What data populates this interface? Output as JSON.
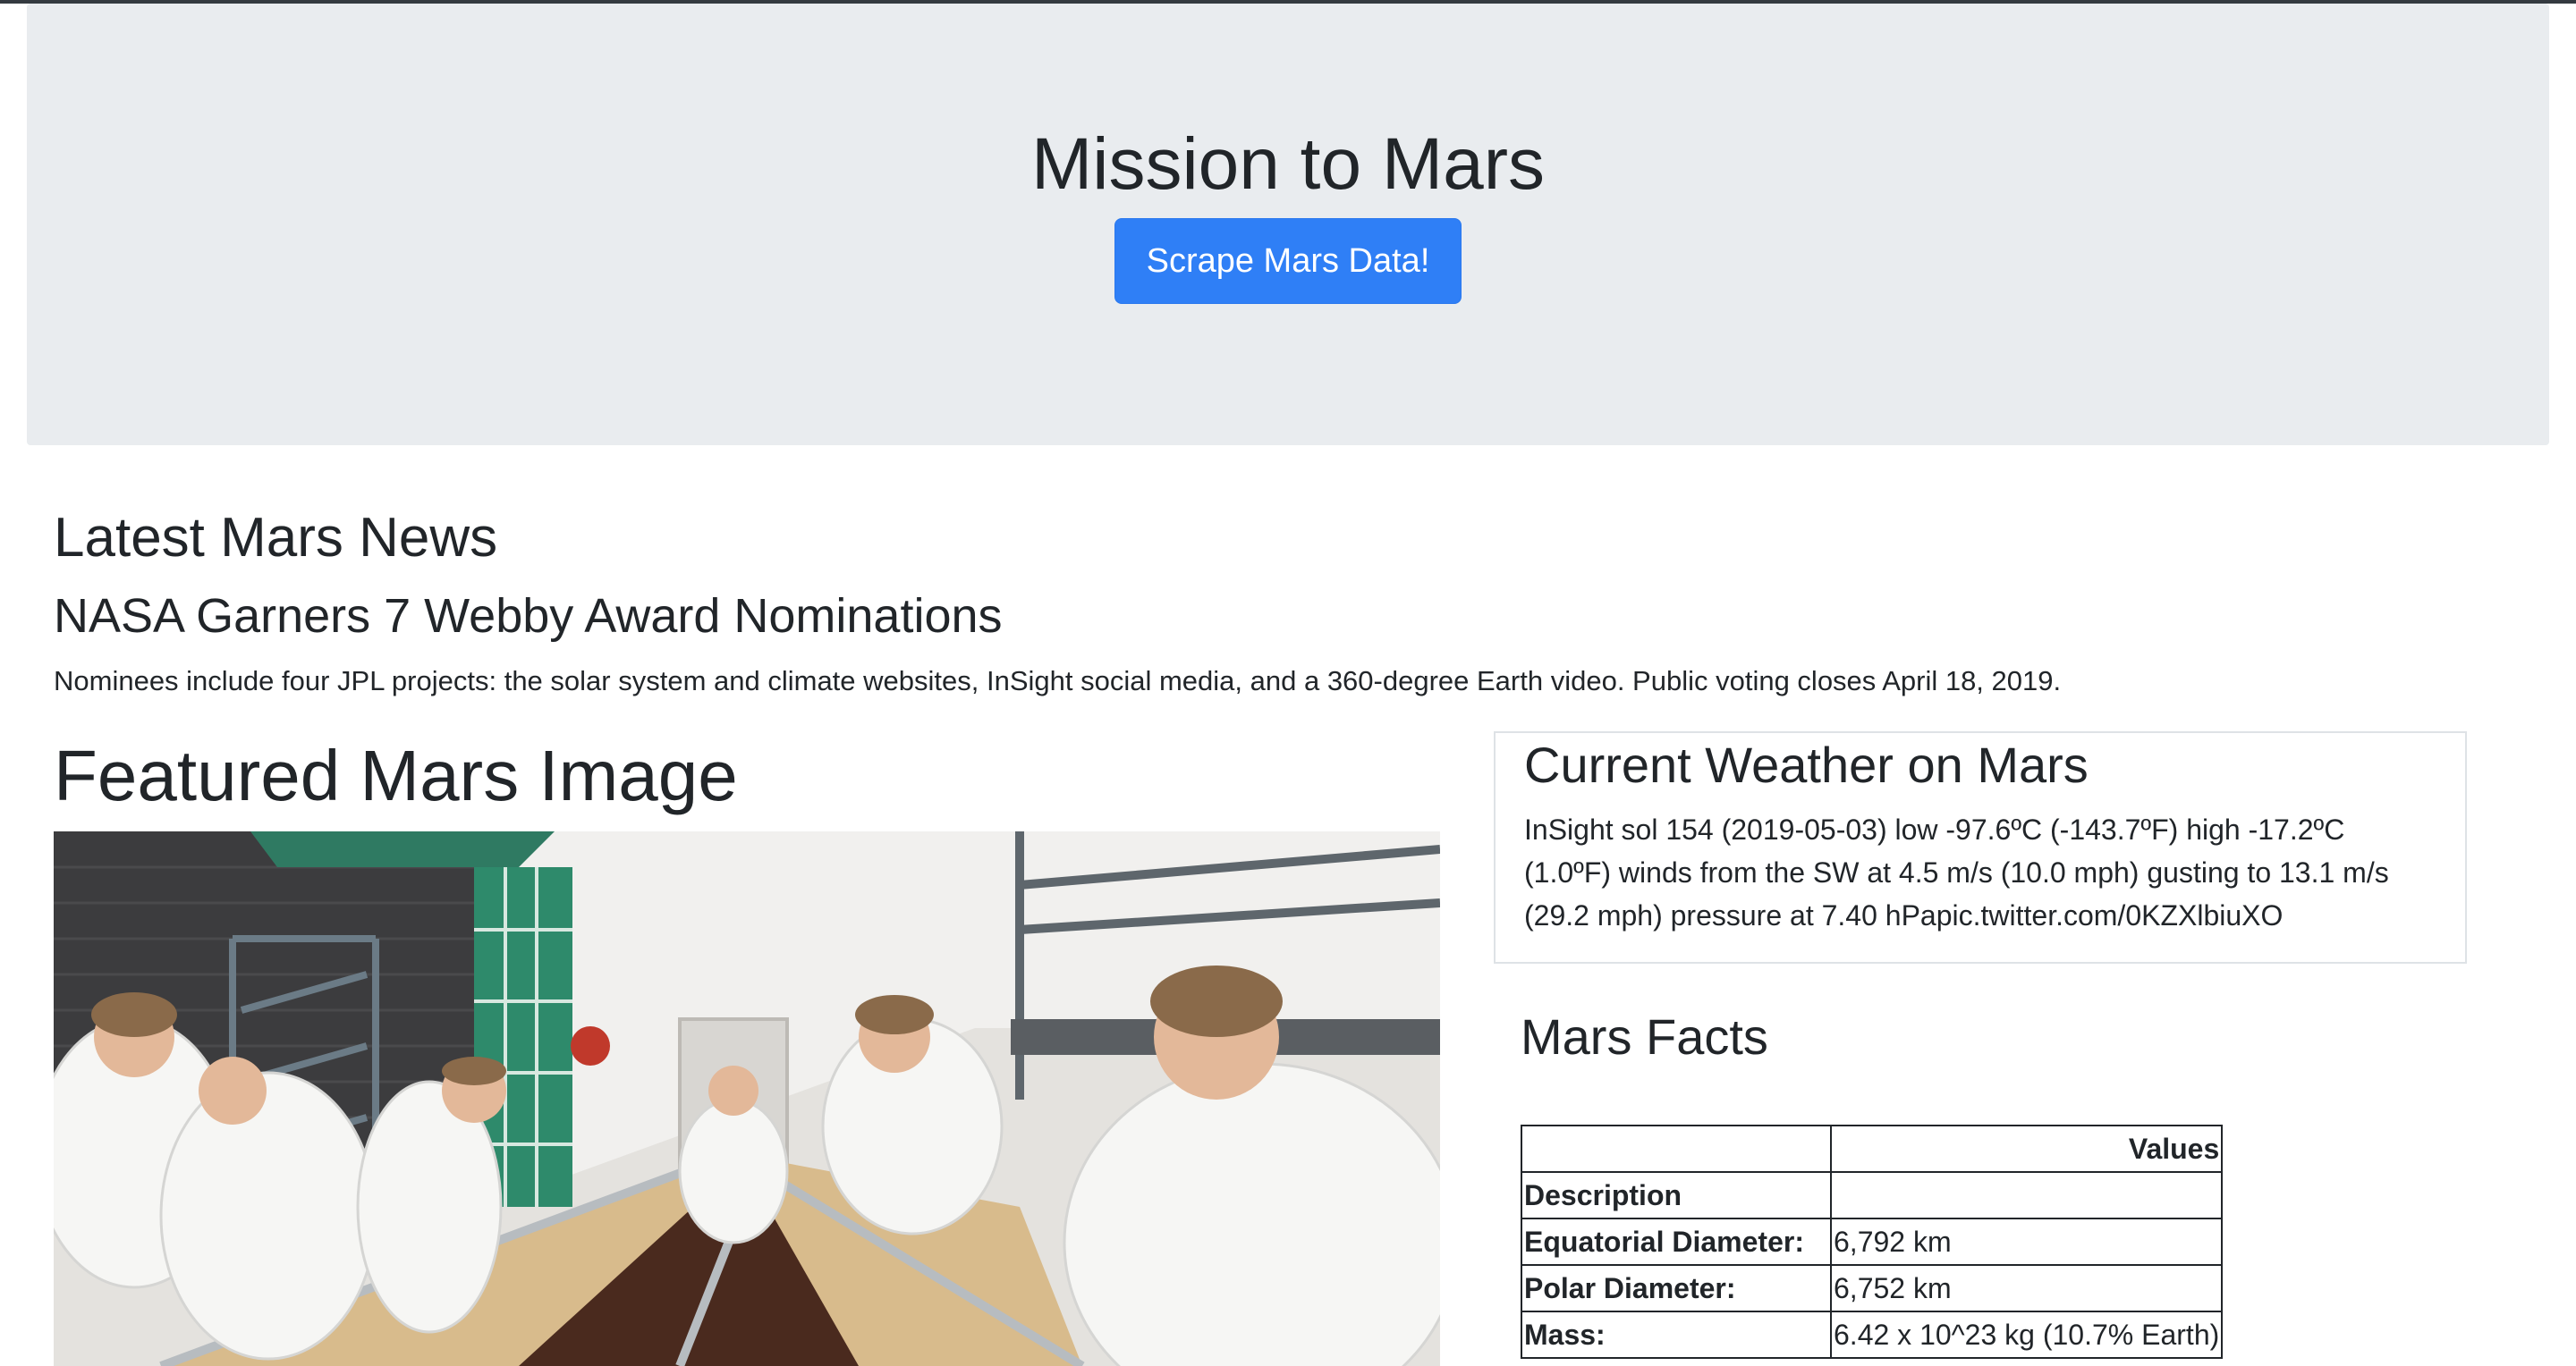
{
  "jumbotron": {
    "title": "Mission to Mars",
    "button_label": "Scrape Mars Data!"
  },
  "news": {
    "heading": "Latest Mars News",
    "title": "NASA Garners 7 Webby Award Nominations",
    "teaser": "Nominees include four JPL projects: the solar system and climate websites, InSight social media, and a 360-degree Earth video. Public voting closes April 18, 2019."
  },
  "featured": {
    "heading": "Featured Mars Image"
  },
  "weather": {
    "heading": "Current Weather on Mars",
    "text": "InSight sol 154 (2019-05-03) low -97.6ºC (-143.7ºF) high -17.2ºC (1.0ºF) winds from the SW at 4.5 m/s (10.0 mph) gusting to 13.1 m/s (29.2 mph) pressure at 7.40 hPapic.twitter.com/0KZXlbiuXO"
  },
  "facts": {
    "heading": "Mars Facts",
    "header_values": "Values",
    "header_description": "Description",
    "rows": [
      {
        "label": "Equatorial Diameter:",
        "value": "6,792 km"
      },
      {
        "label": "Polar Diameter:",
        "value": "6,752 km"
      },
      {
        "label": "Mass:",
        "value": "6.42 x 10^23 kg (10.7% Earth)"
      }
    ]
  }
}
